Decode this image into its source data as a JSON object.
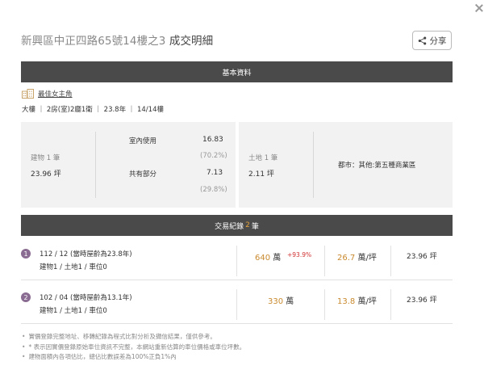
{
  "header": {
    "title": "新興區中正四路65號14樓之3",
    "title_suffix": "成交明細",
    "share_label": "分享"
  },
  "basic_section": {
    "label": "基本資料"
  },
  "community": {
    "name": "最佳女主角"
  },
  "specs": "大樓 ｜ 2房(室)2廳1衛 ｜ 23.8年 ｜ 14/14樓",
  "building_info": {
    "building_label": "建物 1 筆",
    "building_area": "23.96 坪",
    "indoor_label": "室內使用",
    "indoor_value": "16.83",
    "indoor_pct": "(70.2%)",
    "shared_label": "共有部分",
    "shared_value": "7.13",
    "shared_pct": "(29.8%)",
    "land_label": "土地 1 筆",
    "land_area": "2.11 坪",
    "zoning": "都市：其他:第五種商業區"
  },
  "tx_section": {
    "label_pre": "交易紀錄",
    "count": "2",
    "label_post": "筆"
  },
  "transactions": [
    {
      "index": "1",
      "date": "112 / 12 (當時屋齡為23.8年)",
      "detail": "建物1 / 土地1 / 車位0",
      "price": "640",
      "price_unit": "萬",
      "change": "+93.9%",
      "unit_price": "26.7",
      "unit_price_unit": "萬/坪",
      "area": "23.96 坪"
    },
    {
      "index": "2",
      "date": "102 / 04 (當時屋齡為13.1年)",
      "detail": "建物1 / 土地1 / 車位0",
      "price": "330",
      "price_unit": "萬",
      "change": "",
      "unit_price": "13.8",
      "unit_price_unit": "萬/坪",
      "area": "23.96 坪"
    }
  ],
  "notes": [
    "實價登錄完整地址、移轉紀錄為程式比對分析及擷信結果，僅供參考。",
    "* 表示因實價登錄原始車位資訊不完整，本網站重新估算的車位價格或車位坪數。",
    "建物面積內各項估比，總佔比數誤差為100%正負1%內"
  ]
}
